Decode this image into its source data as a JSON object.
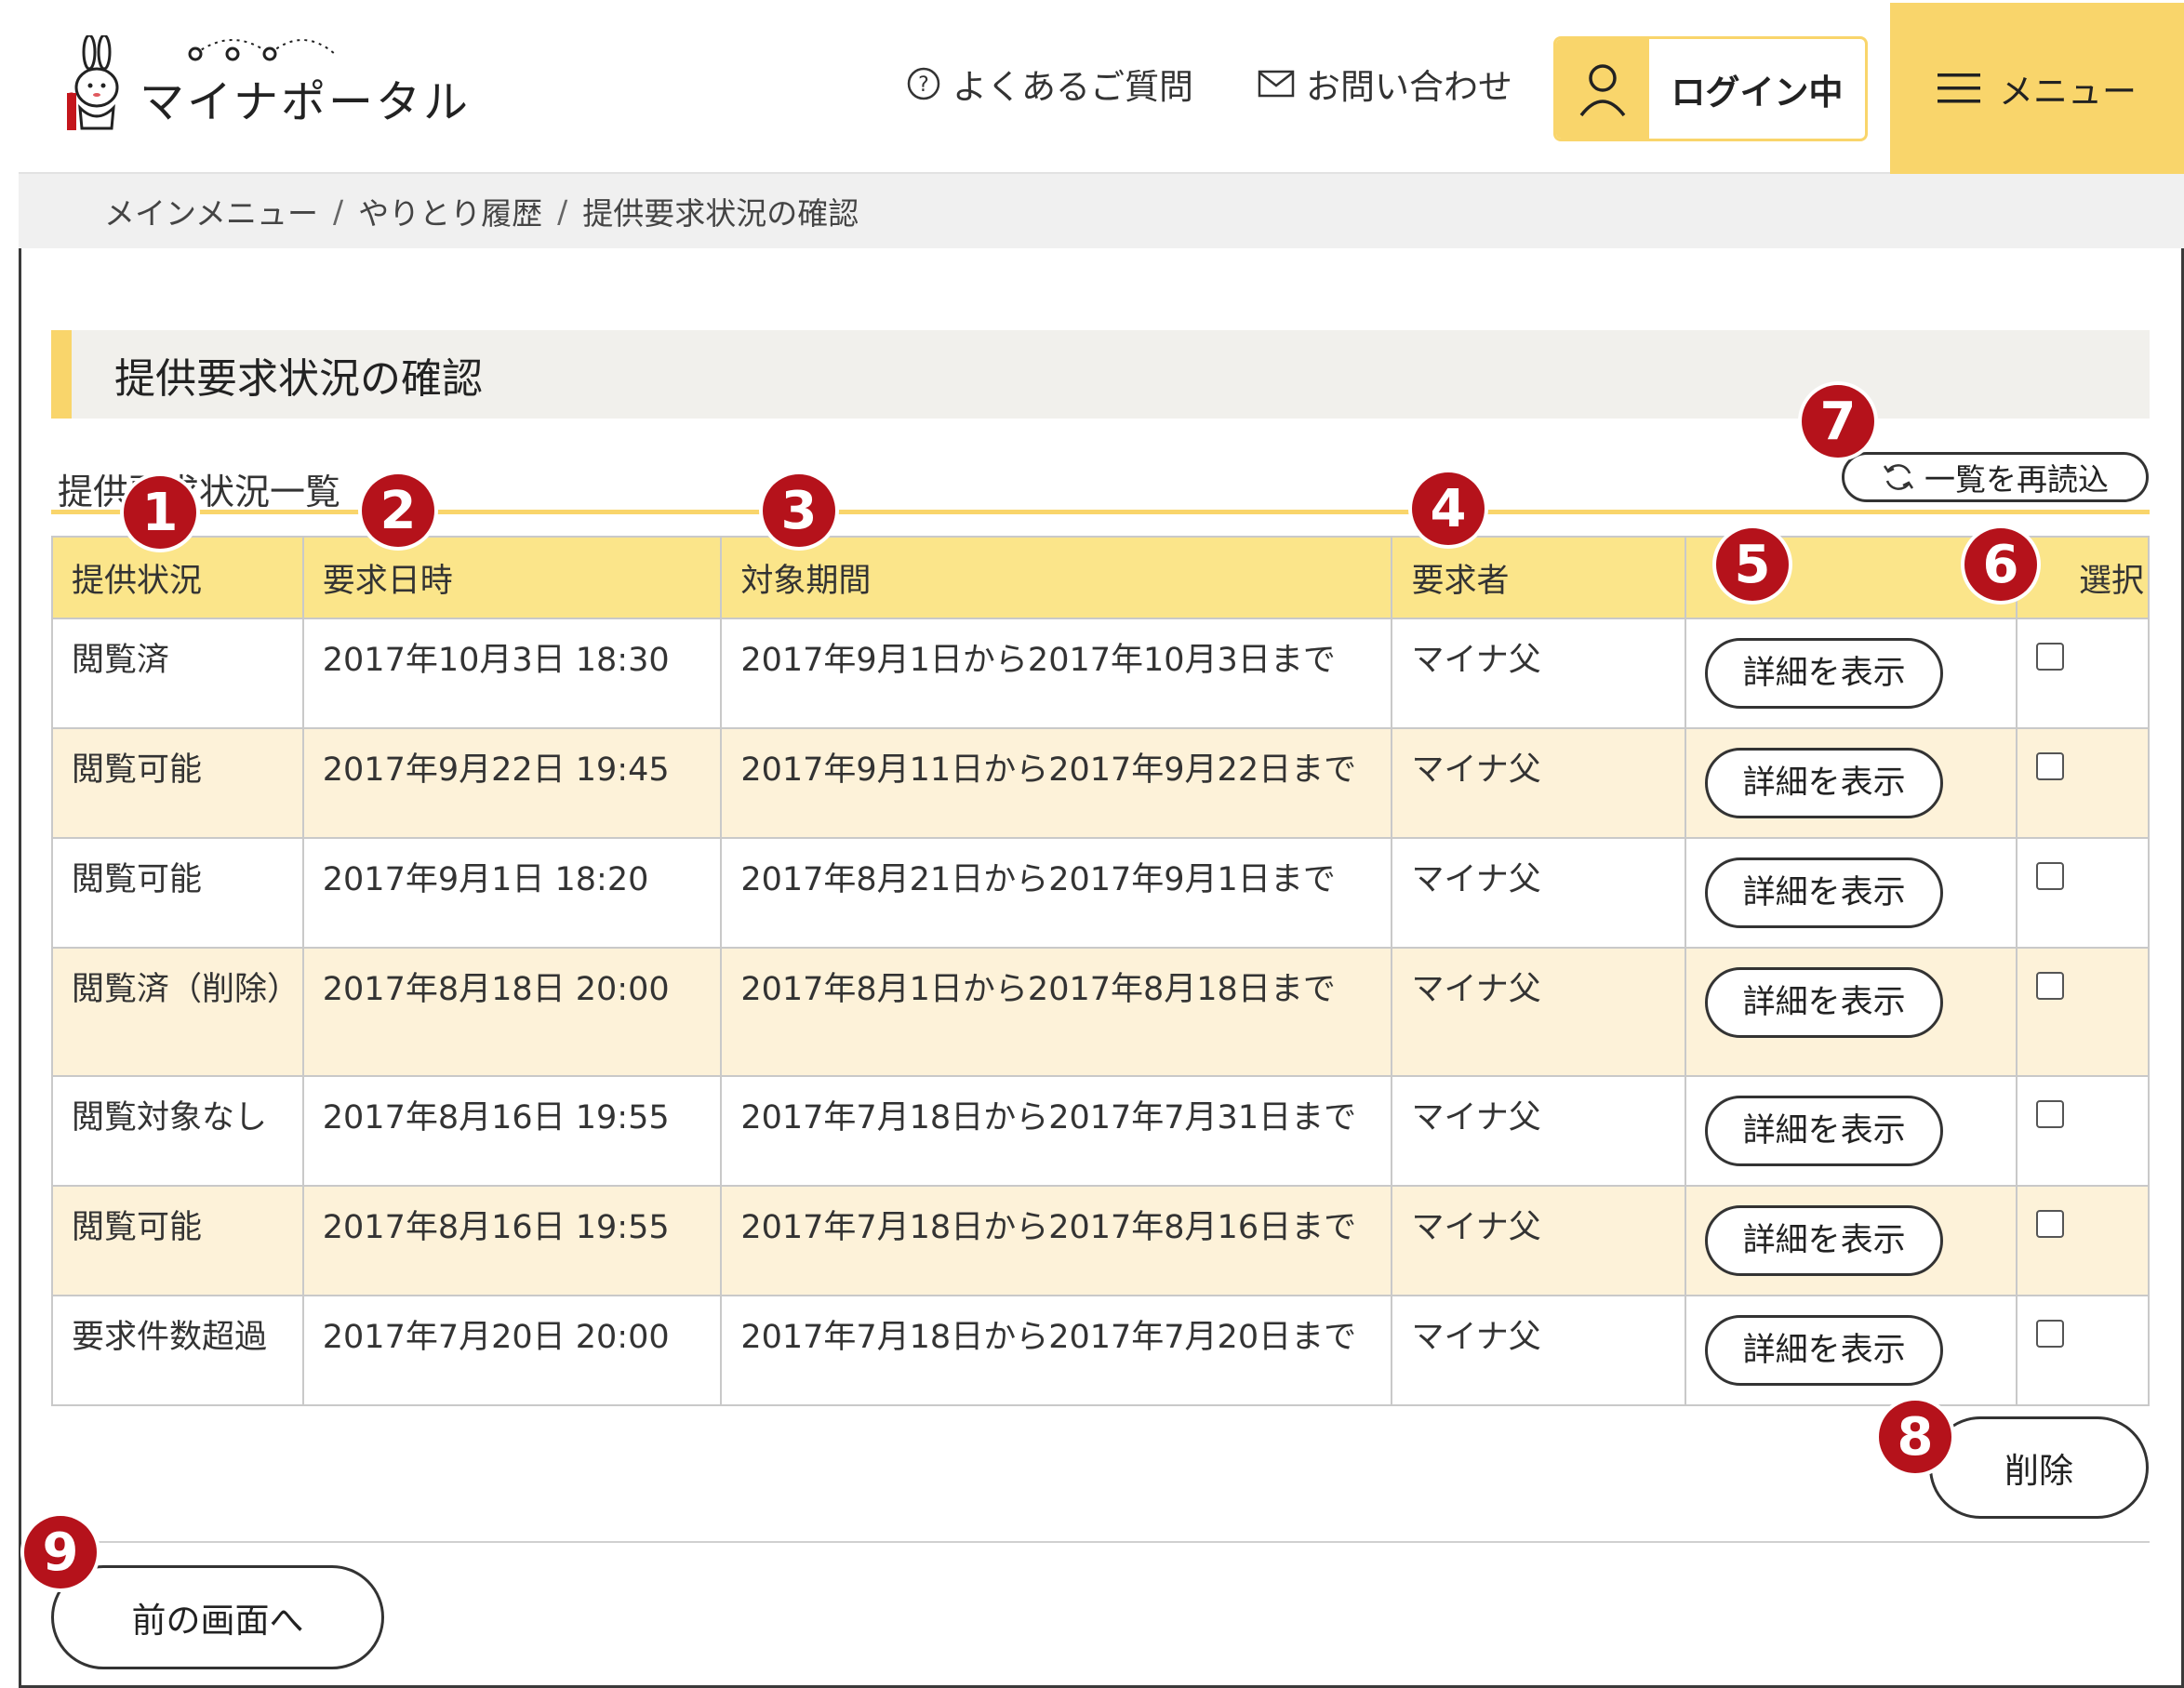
{
  "header": {
    "logo_text": "マイナポータル",
    "faq_label": "よくあるご質問",
    "contact_label": "お問い合わせ",
    "login_label": "ログイン中",
    "menu_label": "メニュー"
  },
  "breadcrumb": {
    "items": [
      "メインメニュー",
      "やりとり履歴",
      "提供要求状況の確認"
    ]
  },
  "page": {
    "title": "提供要求状況の確認",
    "list_caption": "提供要求状況一覧",
    "reload_label": "一覧を再読込"
  },
  "table": {
    "headers": [
      "提供状況",
      "要求日時",
      "対象期間",
      "要求者",
      "",
      "選択"
    ],
    "rows": [
      {
        "status": "閲覧済",
        "datetime": "2017年10月3日 18:30",
        "period": "2017年9月1日から2017年10月3日まで",
        "requester": "マイナ父",
        "button": "詳細を表示"
      },
      {
        "status": "閲覧可能",
        "datetime": "2017年9月22日 19:45",
        "period": "2017年9月11日から2017年9月22日まで",
        "requester": "マイナ父",
        "button": "詳細を表示"
      },
      {
        "status": "閲覧可能",
        "datetime": "2017年9月1日 18:20",
        "period": "2017年8月21日から2017年9月1日まで",
        "requester": "マイナ父",
        "button": "詳細を表示"
      },
      {
        "status": "閲覧済（削除）",
        "datetime": "2017年8月18日 20:00",
        "period": "2017年8月1日から2017年8月18日まで",
        "requester": "マイナ父",
        "button": "詳細を表示"
      },
      {
        "status": "閲覧対象なし",
        "datetime": "2017年8月16日 19:55",
        "period": "2017年7月18日から2017年7月31日まで",
        "requester": "マイナ父",
        "button": "詳細を表示"
      },
      {
        "status": "閲覧可能",
        "datetime": "2017年8月16日 19:55",
        "period": "2017年7月18日から2017年8月16日まで",
        "requester": "マイナ父",
        "button": "詳細を表示"
      },
      {
        "status": "要求件数超過",
        "datetime": "2017年7月20日 20:00",
        "period": "2017年7月18日から2017年7月20日まで",
        "requester": "マイナ父",
        "button": "詳細を表示"
      }
    ]
  },
  "actions": {
    "delete_label": "削除",
    "back_label": "前の画面へ"
  },
  "markers": [
    "1",
    "2",
    "3",
    "4",
    "5",
    "6",
    "7",
    "8",
    "9"
  ],
  "colors": {
    "accent_yellow": "#f9d56b",
    "marker_red": "#b5121b",
    "row_alt": "#fdf2d9",
    "header_row": "#fbe58a"
  }
}
